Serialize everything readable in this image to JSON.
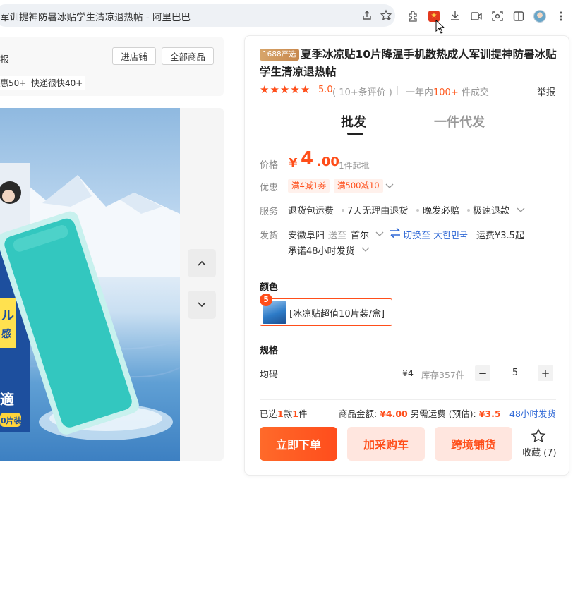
{
  "browser": {
    "tab_title": "军训提神防暑冰贴学生清凉退热帖 - 阿里巴巴"
  },
  "shop": {
    "name_fragment": "报",
    "enter_shop": "进店铺",
    "all_products": "全部商品",
    "tags": [
      "惠50+",
      "快递很快40+"
    ]
  },
  "product": {
    "badge": "1688严选",
    "title": "夏季冰凉贴10片降温手机散热成人军训提神防暑冰贴学生清凉退热帖",
    "rating": "5.0",
    "review_count": "( 10+条评价 )",
    "stars": 5,
    "sold_prefix": "一年内",
    "sold_count": "100+",
    "sold_suffix": " 件成交",
    "report": "举报"
  },
  "tabs": {
    "wholesale": "批发",
    "dropship": "一件代发"
  },
  "price": {
    "label": "价格",
    "currency": "¥",
    "integer": "4",
    "decimal": ".00",
    "moq": "1件起批"
  },
  "promo": {
    "label": "优惠",
    "coupons": [
      "满4减1券",
      "满500减10"
    ]
  },
  "service": {
    "label": "服务",
    "items": [
      "退货包运费",
      "7天无理由退货",
      "晚发必赔",
      "极速退款"
    ]
  },
  "shipping": {
    "label": "发货",
    "origin": "安徽阜阳",
    "to_label": "送至",
    "destination": "首尔",
    "switch_link": "切换至 大한민국",
    "fee": "运费¥3.5起",
    "promise": "承诺48小时发货"
  },
  "color": {
    "title": "颜色",
    "option_count": "5",
    "option_label": "[冰凉贴超值10片装/盒]"
  },
  "spec": {
    "title": "规格",
    "name": "均码",
    "price": "¥4",
    "stock": "库存357件",
    "minus": "−",
    "plus": "+",
    "quantity": "5"
  },
  "summary": {
    "selected_prefix": "已选",
    "selected_kinds": "1",
    "kinds_unit": "款",
    "selected_pieces": "1",
    "pieces_unit": "件",
    "amount_label": "商品金额:",
    "amount": "¥4.00",
    "freight_label": "另需运费 (预估):",
    "freight": "¥3.5",
    "ship_time": "48小时发货"
  },
  "actions": {
    "order": "立即下单",
    "cart": "加采购车",
    "cross_border": "跨境铺货",
    "favorite": "收藏 (7)"
  },
  "colors": {
    "accent": "#ff4e1a",
    "link": "#3069d6",
    "soft_button": "#ffe6df"
  }
}
